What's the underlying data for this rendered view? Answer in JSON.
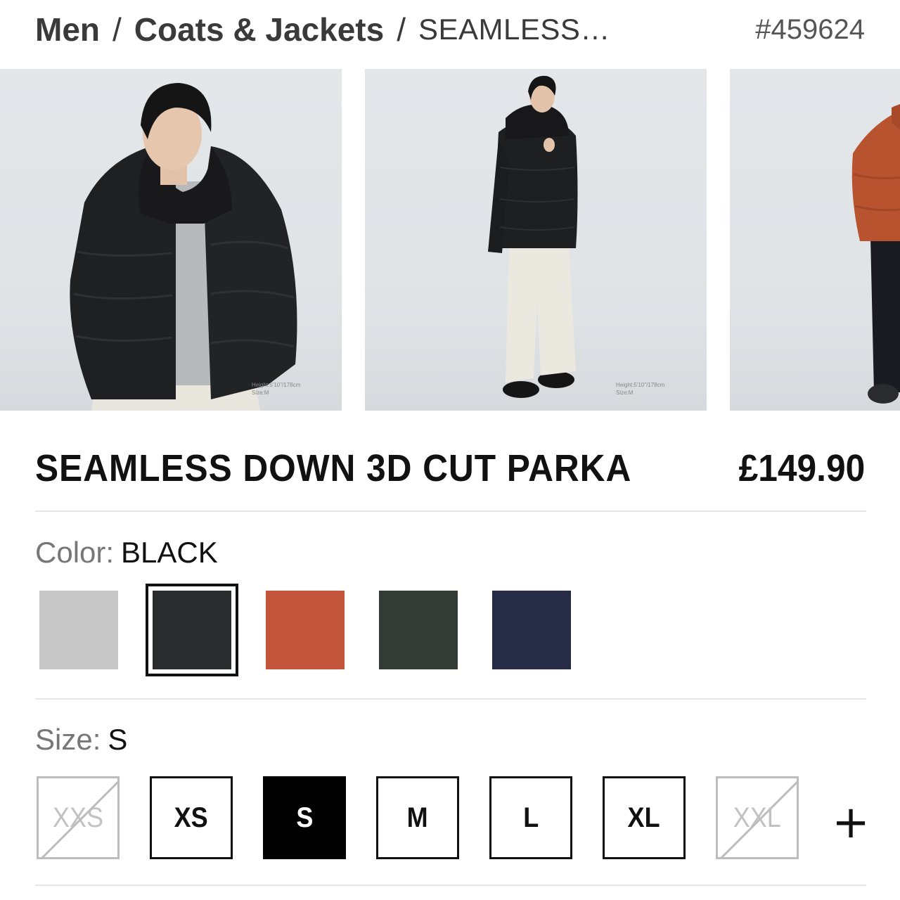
{
  "breadcrumb": {
    "category": "Men",
    "subcategory": "Coats & Jackets",
    "current": "SEAMLESS…",
    "separator": "/"
  },
  "product": {
    "id": "#459624",
    "title": "SEAMLESS DOWN 3D CUT PARKA",
    "price": "£149.90"
  },
  "gallery": {
    "photos": [
      {
        "alt": "Model wearing black parka, close-up",
        "caption_height": "Height:5'10\"/178cm",
        "caption_size": "Size:M"
      },
      {
        "alt": "Model wearing black parka, full body",
        "caption_height": "Height:5'10\"/178cm",
        "caption_size": "Size:M"
      },
      {
        "alt": "Model wearing orange parka"
      }
    ]
  },
  "color": {
    "label": "Color:",
    "value": "BLACK",
    "swatches": [
      {
        "name": "light-gray",
        "hex": "#c8c8c8",
        "selected": false
      },
      {
        "name": "black",
        "hex": "#2b2c2e",
        "selected": true
      },
      {
        "name": "orange",
        "hex": "#c4553d",
        "selected": false
      },
      {
        "name": "dark-green",
        "hex": "#333b36",
        "selected": false
      },
      {
        "name": "navy",
        "hex": "#262c45",
        "selected": false
      }
    ]
  },
  "size": {
    "label": "Size:",
    "value": "S",
    "options": [
      {
        "label": "XXS",
        "state": "unavailable"
      },
      {
        "label": "XS",
        "state": "available"
      },
      {
        "label": "S",
        "state": "selected"
      },
      {
        "label": "M",
        "state": "available"
      },
      {
        "label": "L",
        "state": "available"
      },
      {
        "label": "XL",
        "state": "available"
      },
      {
        "label": "XXL",
        "state": "unavailable"
      }
    ],
    "more_icon": "plus-icon",
    "more_glyph": "+"
  }
}
